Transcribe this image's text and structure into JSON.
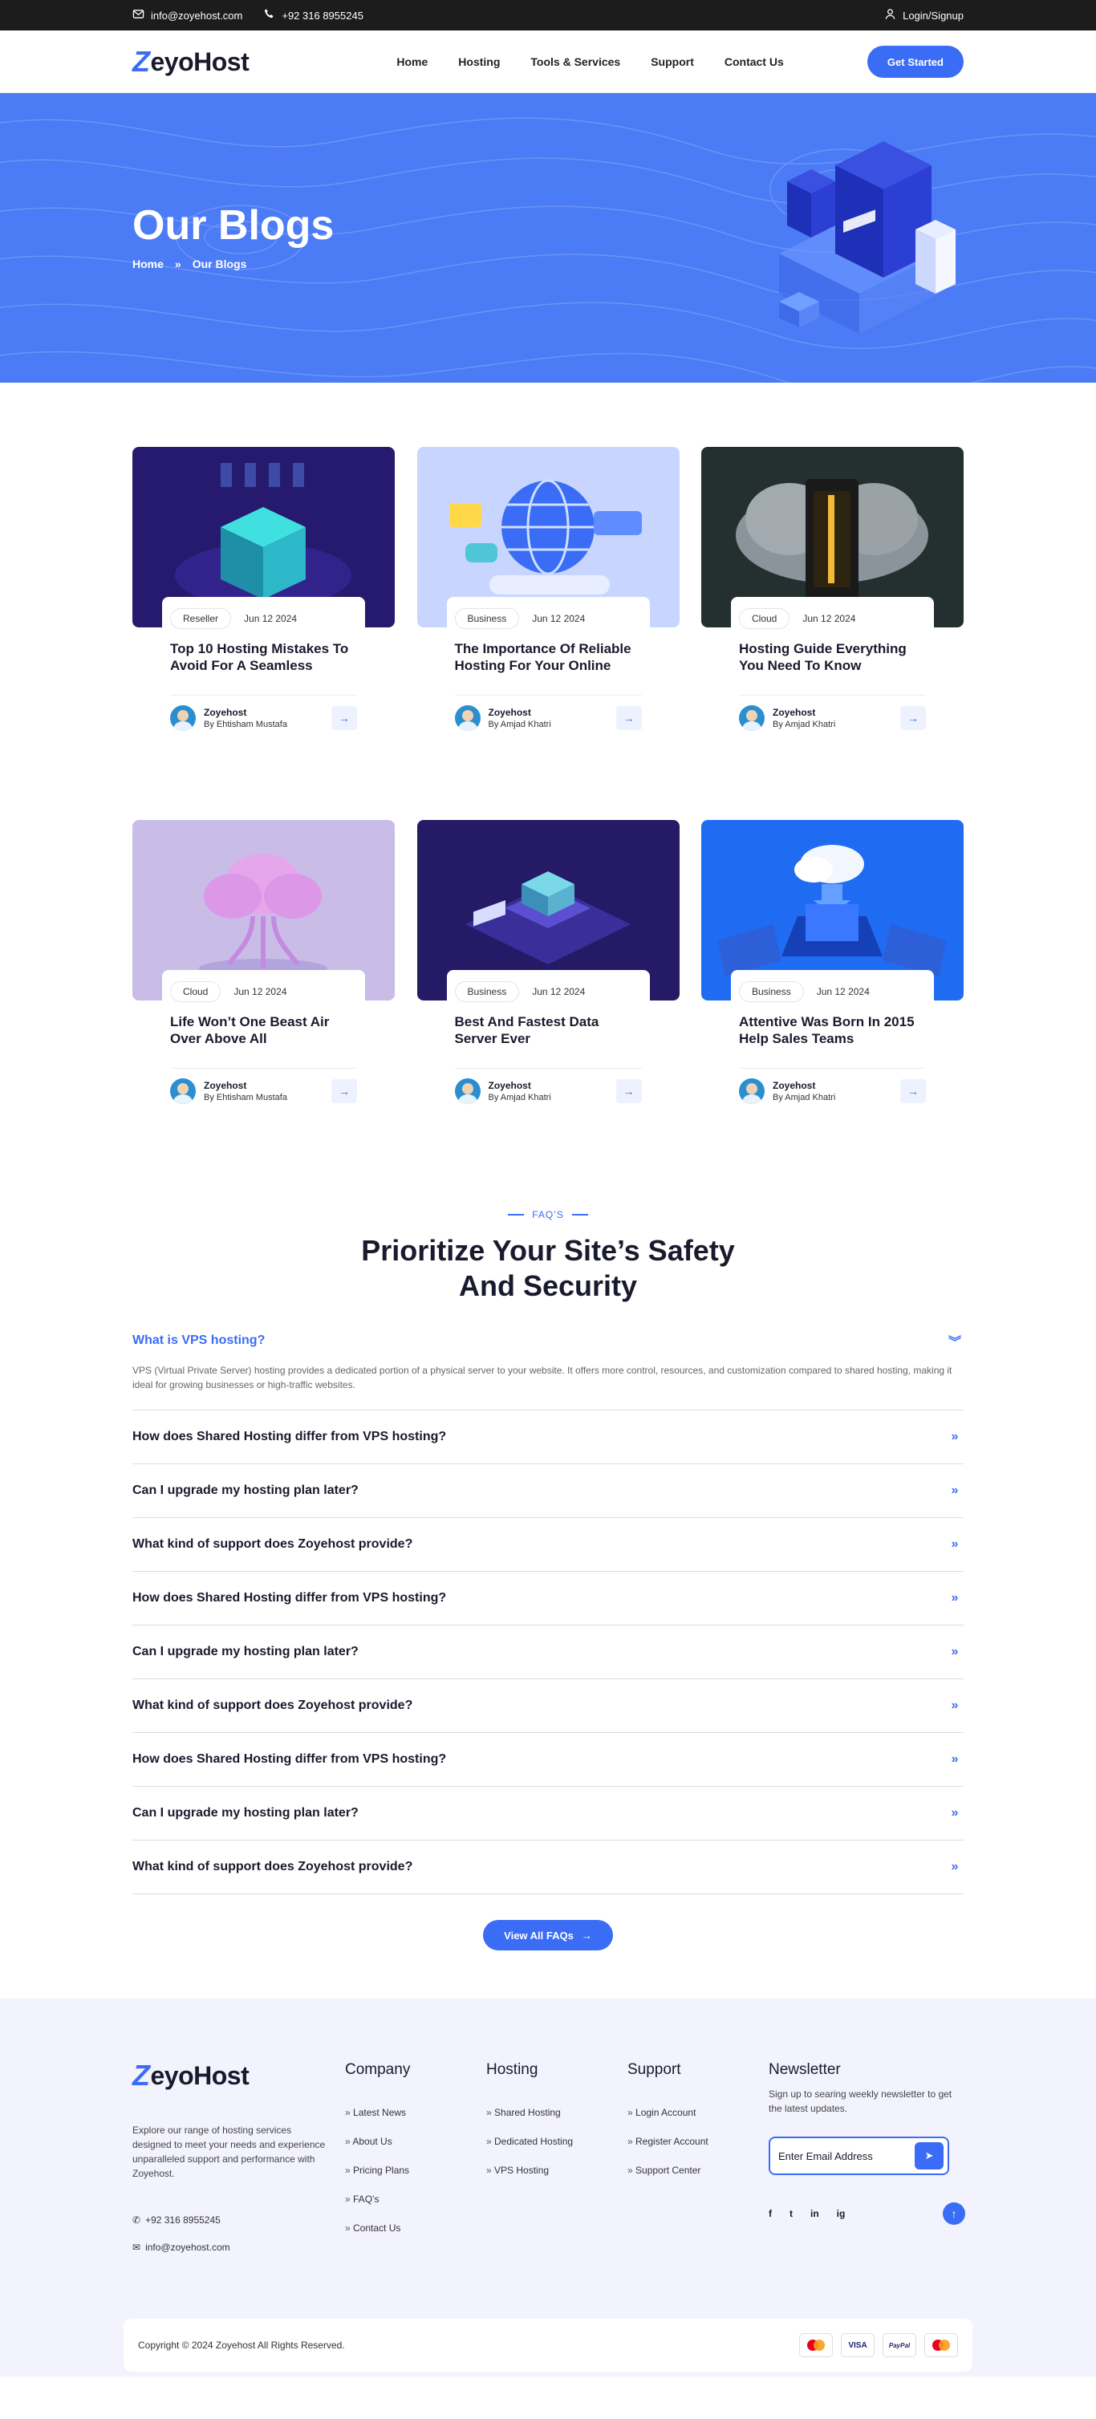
{
  "topbar": {
    "email": "info@zoyehost.com",
    "phone": "+92 316 8955245",
    "login": "Login/Signup"
  },
  "header": {
    "logo_z": "Z",
    "logo_rest": "eyoHost",
    "nav": [
      "Home",
      "Hosting",
      "Tools & Services",
      "Support",
      "Contact Us"
    ],
    "cta": "Get Started"
  },
  "hero": {
    "title": "Our Blogs",
    "breadcrumb_home": "Home",
    "breadcrumb_sep": "»",
    "breadcrumb_current": "Our Blogs"
  },
  "blogs": [
    {
      "tag": "Reseller",
      "date": "Jun 12 2024",
      "title": "Top 10 Hosting Mistakes To Avoid For A Seamless",
      "author": "Zoyehost",
      "by": "By Ehtisham Mustafa"
    },
    {
      "tag": "Business",
      "date": "Jun 12 2024",
      "title": "The Importance Of Reliable Hosting For Your Online",
      "author": "Zoyehost",
      "by": "By Amjad Khatri"
    },
    {
      "tag": "Cloud",
      "date": "Jun 12 2024",
      "title": "Hosting Guide Everything You Need To Know",
      "author": "Zoyehost",
      "by": "By Amjad Khatri"
    },
    {
      "tag": "Cloud",
      "date": "Jun 12 2024",
      "title": "Life Won’t One Beast Air Over Above All",
      "author": "Zoyehost",
      "by": "By Ehtisham Mustafa"
    },
    {
      "tag": "Business",
      "date": "Jun 12 2024",
      "title": "Best And Fastest Data Server Ever",
      "author": "Zoyehost",
      "by": "By Amjad Khatri"
    },
    {
      "tag": "Business",
      "date": "Jun 12 2024",
      "title": "Attentive Was Born In 2015 Help Sales Teams",
      "author": "Zoyehost",
      "by": "By Amjad Khatri"
    }
  ],
  "faq": {
    "tag": "FAQ’S",
    "title_line1": "Prioritize Your Site’s Safety",
    "title_line2": "And Security",
    "items": [
      {
        "q": "What is VPS hosting?",
        "a": "VPS (Virtual Private Server) hosting provides a dedicated portion of a physical server to your website. It offers more control, resources, and customization compared to shared hosting, making it ideal for growing businesses or high-traffic websites."
      },
      {
        "q": "How does Shared Hosting differ from VPS hosting?"
      },
      {
        "q": "Can I upgrade my hosting plan later?"
      },
      {
        "q": "What kind of support does Zoyehost provide?"
      },
      {
        "q": "How does Shared Hosting differ from VPS hosting?"
      },
      {
        "q": "Can I upgrade my hosting plan later?"
      },
      {
        "q": "What kind of support does Zoyehost provide?"
      },
      {
        "q": "How does Shared Hosting differ from VPS hosting?"
      },
      {
        "q": "Can I upgrade my hosting plan later?"
      },
      {
        "q": "What kind of support does Zoyehost provide?"
      }
    ],
    "button": "View All FAQs"
  },
  "footer": {
    "about": "Explore our range of hosting services designed to meet your needs and experience unparalleled support and performance with Zoyehost.",
    "phone": "+92 316 8955245",
    "email": "info@zoyehost.com",
    "company_title": "Company",
    "company_links": [
      "Latest News",
      "About Us",
      "Pricing Plans",
      "FAQ’s",
      "Contact Us"
    ],
    "hosting_title": "Hosting",
    "hosting_links": [
      "Shared Hosting",
      "Dedicated Hosting",
      "VPS Hosting"
    ],
    "support_title": "Support",
    "support_links": [
      "Login Account",
      "Register Account",
      "Support Center"
    ],
    "newsletter_title": "Newsletter",
    "newsletter_text": "Sign up to searing weekly newsletter to get the latest updates.",
    "newsletter_placeholder": "Enter Email Address",
    "social": [
      "f",
      "t",
      "in",
      "ig"
    ],
    "copyright": "Copyright © 2024 Zoyehost All Rights Reserved.",
    "payments": [
      "mastercard",
      "VISA",
      "PayPal",
      "mastercard"
    ]
  },
  "colors": {
    "accent": "#3b6cf6",
    "hero": "#4b7bf5",
    "topbar": "#1c1c1c",
    "footer_bg": "#f3f3fd"
  }
}
